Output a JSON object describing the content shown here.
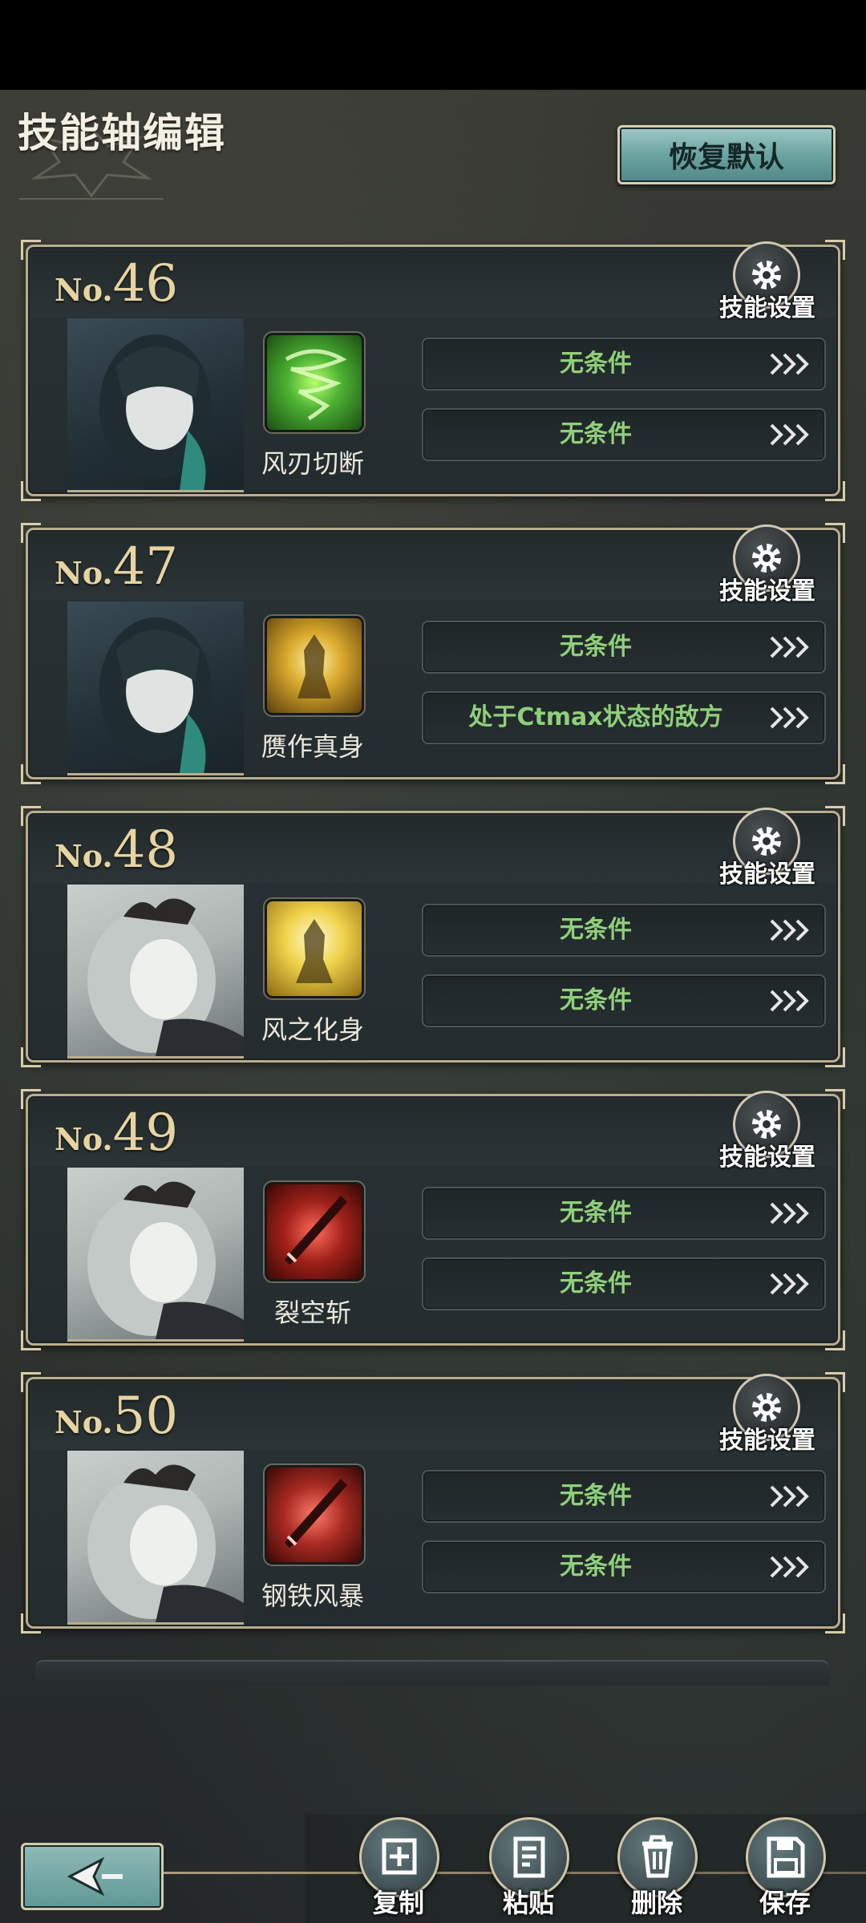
{
  "header": {
    "title": "技能轴编辑",
    "restore_label": "恢复默认"
  },
  "accent_colors": {
    "condition_text": "#8fd07a",
    "frame_gold": "#b9ad8c",
    "teal_button": "#6fa7a4"
  },
  "cards": [
    {
      "no_prefix": "No.",
      "number": "46",
      "gear_label": "技能设置",
      "skill_name": "风刃切断",
      "icon_color": "green-tornado",
      "conditions": [
        "无条件",
        "无条件"
      ]
    },
    {
      "no_prefix": "No.",
      "number": "47",
      "gear_label": "技能设置",
      "skill_name": "赝作真身",
      "icon_color": "gold-warrior",
      "conditions": [
        "无条件",
        "处于Ctmax状态的敌方"
      ]
    },
    {
      "no_prefix": "No.",
      "number": "48",
      "gear_label": "技能设置",
      "skill_name": "风之化身",
      "icon_color": "gold-light",
      "conditions": [
        "无条件",
        "无条件"
      ]
    },
    {
      "no_prefix": "No.",
      "number": "49",
      "gear_label": "技能设置",
      "skill_name": "裂空斩",
      "icon_color": "red-sword",
      "conditions": [
        "无条件",
        "无条件"
      ]
    },
    {
      "no_prefix": "No.",
      "number": "50",
      "gear_label": "技能设置",
      "skill_name": "钢铁风暴",
      "icon_color": "red-sword",
      "conditions": [
        "无条件",
        "无条件"
      ]
    }
  ],
  "toolbar": {
    "copy_label": "复制",
    "paste_label": "粘贴",
    "delete_label": "删除",
    "save_label": "保存"
  }
}
